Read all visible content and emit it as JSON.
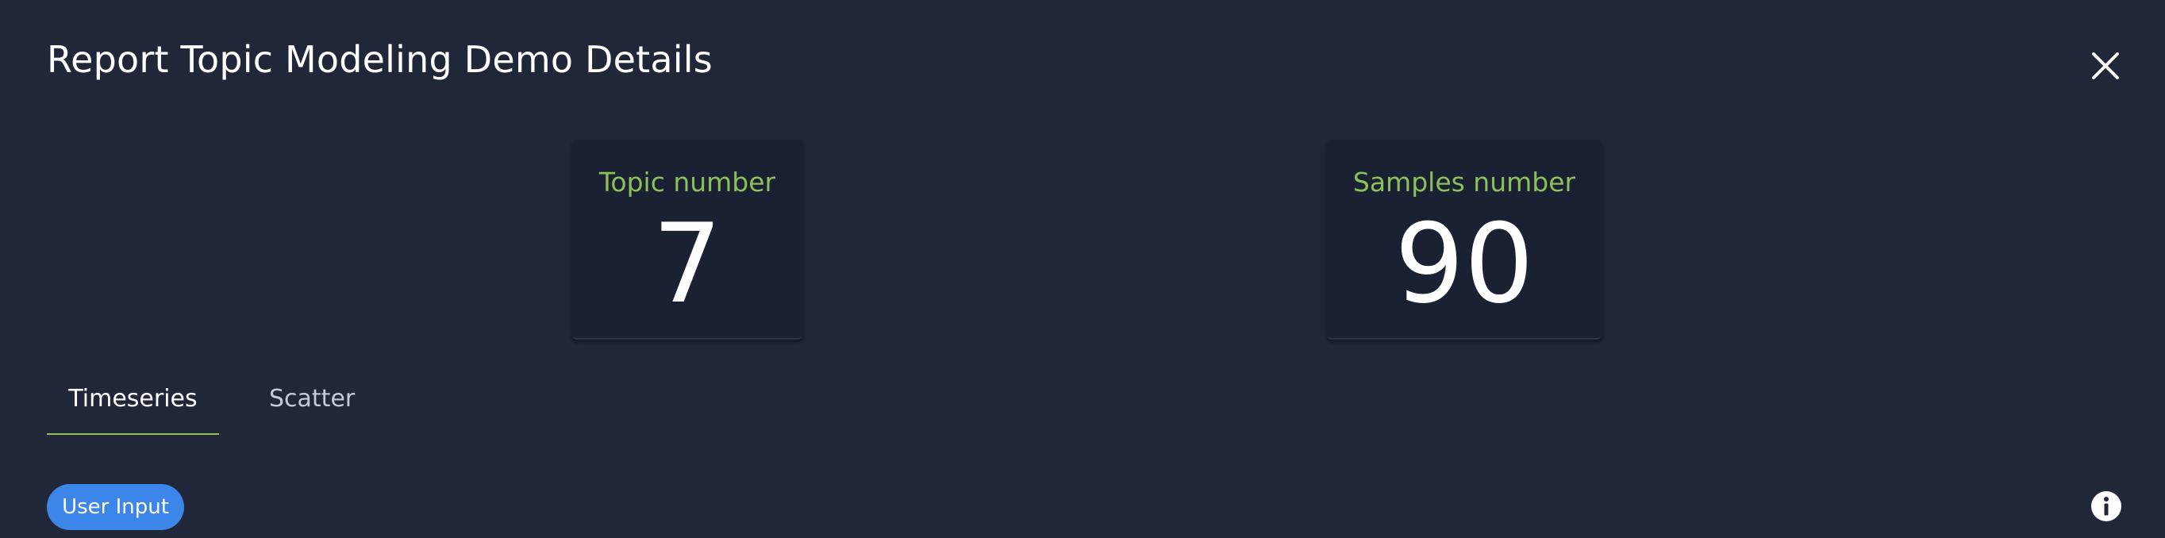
{
  "dialog": {
    "title": "Report Topic Modeling Demo Details",
    "close_icon": "close-icon"
  },
  "stats": {
    "topics": {
      "label": "Topic number",
      "value": "7"
    },
    "samples": {
      "label": "Samples number",
      "value": "90"
    }
  },
  "tabs": [
    {
      "label": "Timeseries",
      "active": true
    },
    {
      "label": "Scatter",
      "active": false
    }
  ],
  "actions": {
    "user_input_label": "User Input",
    "info_icon": "info-icon"
  },
  "colors": {
    "background": "#1f2738",
    "card_background": "#192133",
    "accent_green": "#8fbf5a",
    "primary_blue": "#3b86e8"
  }
}
